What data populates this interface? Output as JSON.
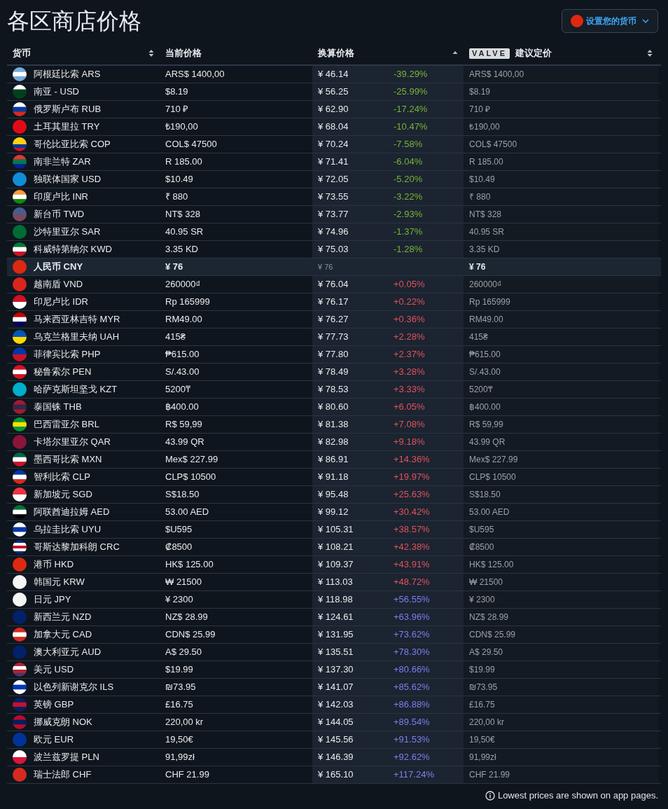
{
  "title": "各区商店价格",
  "currency_button": {
    "label": "设置您的货币"
  },
  "columns": [
    {
      "label": "货币",
      "kind": "sortable"
    },
    {
      "label": "当前价格",
      "kind": "plain"
    },
    {
      "label": "换算价格",
      "kind": "sorted"
    },
    {
      "badge": "VALVE",
      "label": "建议定价",
      "kind": "sortable"
    }
  ],
  "rows": [
    {
      "name": "阿根廷比索 ARS",
      "current": "ARS$ 1400,00",
      "converted": "¥ 46.14",
      "diff": "-39.29%",
      "color": "#79b33a",
      "suggested": "ARS$ 1400,00",
      "selected": false
    },
    {
      "name": "南亚 - USD",
      "current": "$8.19",
      "converted": "¥ 56.25",
      "diff": "-25.99%",
      "color": "#79b33a",
      "suggested": "$8.19",
      "selected": false
    },
    {
      "name": "俄罗斯卢布 RUB",
      "current": "710 ₽",
      "converted": "¥ 62.90",
      "diff": "-17.24%",
      "color": "#79b33a",
      "suggested": "710 ₽",
      "selected": false
    },
    {
      "name": "土耳其里拉 TRY",
      "current": "₺190,00",
      "converted": "¥ 68.04",
      "diff": "-10.47%",
      "color": "#79b33a",
      "suggested": "₺190,00",
      "selected": false
    },
    {
      "name": "哥伦比亚比索 COP",
      "current": "COL$ 47500",
      "converted": "¥ 70.24",
      "diff": "-7.58%",
      "color": "#79b33a",
      "suggested": "COL$ 47500",
      "selected": false
    },
    {
      "name": "南非兰特 ZAR",
      "current": "R 185.00",
      "converted": "¥ 71.41",
      "diff": "-6.04%",
      "color": "#79b33a",
      "suggested": "R 185.00",
      "selected": false
    },
    {
      "name": "独联体国家 USD",
      "current": "$10.49",
      "converted": "¥ 72.05",
      "diff": "-5.20%",
      "color": "#79b33a",
      "suggested": "$10.49",
      "selected": false
    },
    {
      "name": "印度卢比 INR",
      "current": "₹ 880",
      "converted": "¥ 73.55",
      "diff": "-3.22%",
      "color": "#79b33a",
      "suggested": "₹ 880",
      "selected": false
    },
    {
      "name": "新台币 TWD",
      "current": "NT$ 328",
      "converted": "¥ 73.77",
      "diff": "-2.93%",
      "color": "#79b33a",
      "suggested": "NT$ 328",
      "selected": false
    },
    {
      "name": "沙特里亚尔 SAR",
      "current": "40.95 SR",
      "converted": "¥ 74.96",
      "diff": "-1.37%",
      "color": "#79b33a",
      "suggested": "40.95 SR",
      "selected": false
    },
    {
      "name": "科威特第纳尔 KWD",
      "current": "3.35 KD",
      "converted": "¥ 75.03",
      "diff": "-1.28%",
      "color": "#79b33a",
      "suggested": "3.35 KD",
      "selected": false
    },
    {
      "name": "人民币 CNY",
      "current": "¥ 76",
      "converted": "¥ 76",
      "suggested": "¥ 76",
      "selected": true
    },
    {
      "name": "越南盾 VND",
      "current": "260000₫",
      "converted": "¥ 76.04",
      "diff": "+0.05%",
      "color": "#e0535e",
      "suggested": "260000₫",
      "selected": false
    },
    {
      "name": "印尼卢比 IDR",
      "current": "Rp 165999",
      "converted": "¥ 76.17",
      "diff": "+0.22%",
      "color": "#e0535e",
      "suggested": "Rp 165999",
      "selected": false
    },
    {
      "name": "马来西亚林吉特 MYR",
      "current": "RM49.00",
      "converted": "¥ 76.27",
      "diff": "+0.36%",
      "color": "#e0535e",
      "suggested": "RM49.00",
      "selected": false
    },
    {
      "name": "乌克兰格里夫纳 UAH",
      "current": "415₴",
      "converted": "¥ 77.73",
      "diff": "+2.28%",
      "color": "#e0535e",
      "suggested": "415₴",
      "selected": false
    },
    {
      "name": "菲律宾比索 PHP",
      "current": "₱615.00",
      "converted": "¥ 77.80",
      "diff": "+2.37%",
      "color": "#e0535e",
      "suggested": "₱615.00",
      "selected": false
    },
    {
      "name": "秘鲁索尔 PEN",
      "current": "S/.43.00",
      "converted": "¥ 78.49",
      "diff": "+3.28%",
      "color": "#e0535e",
      "suggested": "S/.43.00",
      "selected": false
    },
    {
      "name": "哈萨克斯坦坚戈 KZT",
      "current": "5200₸",
      "converted": "¥ 78.53",
      "diff": "+3.33%",
      "color": "#e0535e",
      "suggested": "5200₸",
      "selected": false
    },
    {
      "name": "泰国铢 THB",
      "current": "฿400.00",
      "converted": "¥ 80.60",
      "diff": "+6.05%",
      "color": "#e0535e",
      "suggested": "฿400.00",
      "selected": false
    },
    {
      "name": "巴西雷亚尔 BRL",
      "current": "R$ 59,99",
      "converted": "¥ 81.38",
      "diff": "+7.08%",
      "color": "#e0535e",
      "suggested": "R$ 59,99",
      "selected": false
    },
    {
      "name": "卡塔尔里亚尔 QAR",
      "current": "43.99 QR",
      "converted": "¥ 82.98",
      "diff": "+9.18%",
      "color": "#e0535e",
      "suggested": "43.99 QR",
      "selected": false
    },
    {
      "name": "墨西哥比索 MXN",
      "current": "Mex$ 227.99",
      "converted": "¥ 86.91",
      "diff": "+14.36%",
      "color": "#e0535e",
      "suggested": "Mex$ 227.99",
      "selected": false
    },
    {
      "name": "智利比索 CLP",
      "current": "CLP$ 10500",
      "converted": "¥ 91.18",
      "diff": "+19.97%",
      "color": "#e0535e",
      "suggested": "CLP$ 10500",
      "selected": false
    },
    {
      "name": "新加坡元 SGD",
      "current": "S$18.50",
      "converted": "¥ 95.48",
      "diff": "+25.63%",
      "color": "#e0535e",
      "suggested": "S$18.50",
      "selected": false
    },
    {
      "name": "阿联酋迪拉姆 AED",
      "current": "53.00 AED",
      "converted": "¥ 99.12",
      "diff": "+30.42%",
      "color": "#e0535e",
      "suggested": "53.00 AED",
      "selected": false
    },
    {
      "name": "乌拉圭比索 UYU",
      "current": "$U595",
      "converted": "¥ 105.31",
      "diff": "+38.57%",
      "color": "#e0535e",
      "suggested": "$U595",
      "selected": false
    },
    {
      "name": "哥斯达黎加科朗 CRC",
      "current": "₡8500",
      "converted": "¥ 108.21",
      "diff": "+42.38%",
      "color": "#e0535e",
      "suggested": "₡8500",
      "selected": false
    },
    {
      "name": "港币 HKD",
      "current": "HK$ 125.00",
      "converted": "¥ 109.37",
      "diff": "+43.91%",
      "color": "#e0535e",
      "suggested": "HK$ 125.00",
      "selected": false
    },
    {
      "name": "韩国元 KRW",
      "current": "₩ 21500",
      "converted": "¥ 113.03",
      "diff": "+48.72%",
      "color": "#e0535e",
      "suggested": "₩ 21500",
      "selected": false
    },
    {
      "name": "日元 JPY",
      "current": "¥ 2300",
      "converted": "¥ 118.98",
      "diff": "+56.55%",
      "color": "#7d7ff0",
      "suggested": "¥ 2300",
      "selected": false
    },
    {
      "name": "新西兰元 NZD",
      "current": "NZ$ 28.99",
      "converted": "¥ 124.61",
      "diff": "+63.96%",
      "color": "#7d7ff0",
      "suggested": "NZ$ 28.99",
      "selected": false
    },
    {
      "name": "加拿大元 CAD",
      "current": "CDN$ 25.99",
      "converted": "¥ 131.95",
      "diff": "+73.62%",
      "color": "#7d7ff0",
      "suggested": "CDN$ 25.99",
      "selected": false
    },
    {
      "name": "澳大利亚元 AUD",
      "current": "A$ 29.50",
      "converted": "¥ 135.51",
      "diff": "+78.30%",
      "color": "#7d7ff0",
      "suggested": "A$ 29.50",
      "selected": false
    },
    {
      "name": "美元 USD",
      "current": "$19.99",
      "converted": "¥ 137.30",
      "diff": "+80.66%",
      "color": "#7d7ff0",
      "suggested": "$19.99",
      "selected": false
    },
    {
      "name": "以色列新谢克尔 ILS",
      "current": "₪73.95",
      "converted": "¥ 141.07",
      "diff": "+85.62%",
      "color": "#7d7ff0",
      "suggested": "₪73.95",
      "selected": false
    },
    {
      "name": "英镑 GBP",
      "current": "£16.75",
      "converted": "¥ 142.03",
      "diff": "+86.88%",
      "color": "#7d7ff0",
      "suggested": "£16.75",
      "selected": false
    },
    {
      "name": "挪威克朗 NOK",
      "current": "220,00 kr",
      "converted": "¥ 144.05",
      "diff": "+89.54%",
      "color": "#7d7ff0",
      "suggested": "220,00 kr",
      "selected": false
    },
    {
      "name": "欧元 EUR",
      "current": "19,50€",
      "converted": "¥ 145.56",
      "diff": "+91.53%",
      "color": "#7d7ff0",
      "suggested": "19,50€",
      "selected": false
    },
    {
      "name": "波兰兹罗提 PLN",
      "current": "91,99zł",
      "converted": "¥ 146.39",
      "diff": "+92.62%",
      "color": "#7d7ff0",
      "suggested": "91,99zł",
      "selected": false
    },
    {
      "name": "瑞士法郎 CHF",
      "current": "CHF 21.99",
      "converted": "¥ 165.10",
      "diff": "+117.24%",
      "color": "#7d7ff0",
      "suggested": "CHF 21.99",
      "selected": false
    }
  ],
  "footer_note": "Lowest prices are shown on app pages."
}
